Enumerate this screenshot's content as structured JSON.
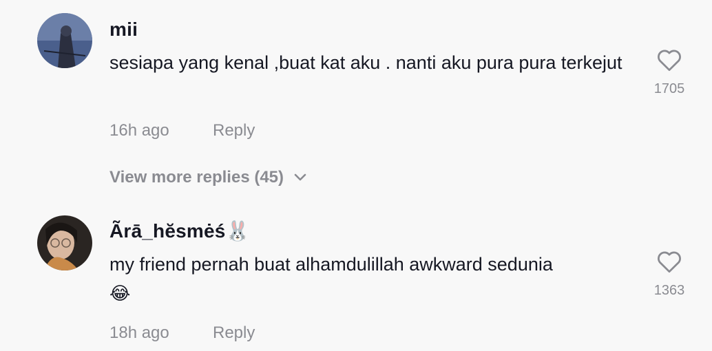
{
  "comments": [
    {
      "username": "mii",
      "text": "sesiapa yang kenal ,buat kat aku . nanti aku pura pura terkejut",
      "emoji": "",
      "time": "16h ago",
      "reply_label": "Reply",
      "likes": "1705"
    },
    {
      "username": "Ãrā_hĕsmėś🐰",
      "text": "my friend pernah buat alhamdulillah awkward sedunia",
      "emoji": "😂",
      "time": "18h ago",
      "reply_label": "Reply",
      "likes": "1363"
    }
  ],
  "view_more": "View more replies (45)",
  "colors": {
    "background": "#f8f8f8",
    "primary_text": "#161823",
    "secondary_text": "#8a8b91"
  },
  "icons": [
    "heart-icon",
    "chevron-down-icon"
  ]
}
